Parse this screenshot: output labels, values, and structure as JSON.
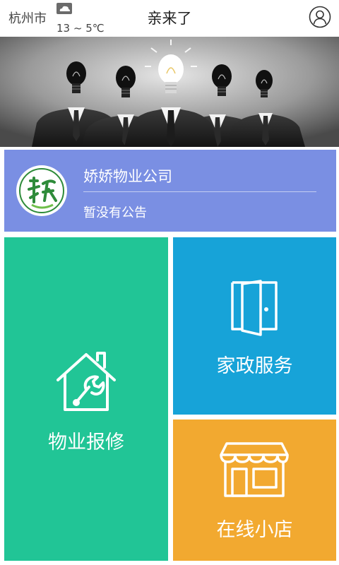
{
  "header": {
    "city": "杭州市",
    "temperature": "13 ~ 5℃",
    "weather_icon": "cloud-icon",
    "title": "亲来了",
    "user_icon": "user-icon"
  },
  "banner": {
    "image": "businessmen-lightbulb-heads-banner"
  },
  "company": {
    "name": "娇娇物业公司",
    "notice": "暂没有公告",
    "logo_icon": "company-logo",
    "color": "#7a8fe3"
  },
  "tiles": {
    "repair": {
      "label": "物业报修",
      "icon": "house-wrench-icon",
      "color": "#21c596"
    },
    "housekeeping": {
      "label": "家政服务",
      "icon": "door-icon",
      "color": "#17a3d8"
    },
    "shop": {
      "label": "在线小店",
      "icon": "store-icon",
      "color": "#f2a930"
    }
  }
}
